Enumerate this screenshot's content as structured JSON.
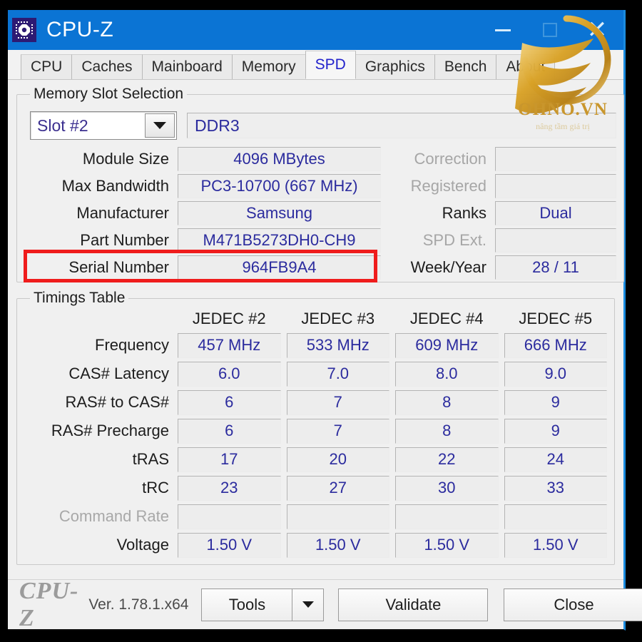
{
  "window": {
    "title": "CPU-Z",
    "icon": "cpuz-chip-icon",
    "controls": {
      "minimize": "–",
      "maximize": "□",
      "close": "✕"
    }
  },
  "tabs": [
    {
      "label": "CPU",
      "active": false
    },
    {
      "label": "Caches",
      "active": false
    },
    {
      "label": "Mainboard",
      "active": false
    },
    {
      "label": "Memory",
      "active": false
    },
    {
      "label": "SPD",
      "active": true
    },
    {
      "label": "Graphics",
      "active": false
    },
    {
      "label": "Bench",
      "active": false
    },
    {
      "label": "About",
      "active": false
    }
  ],
  "slot_selection": {
    "legend": "Memory Slot Selection",
    "slot": "Slot #2",
    "memory_type": "DDR3",
    "left_rows": [
      {
        "label": "Module Size",
        "value": "4096 MBytes",
        "disabled": false
      },
      {
        "label": "Max Bandwidth",
        "value": "PC3-10700 (667 MHz)",
        "disabled": false
      },
      {
        "label": "Manufacturer",
        "value": "Samsung",
        "disabled": false
      },
      {
        "label": "Part Number",
        "value": "M471B5273DH0-CH9",
        "disabled": false
      },
      {
        "label": "Serial Number",
        "value": "964FB9A4",
        "disabled": false
      }
    ],
    "right_rows": [
      {
        "label": "Correction",
        "value": "",
        "disabled": true
      },
      {
        "label": "Registered",
        "value": "",
        "disabled": true
      },
      {
        "label": "Ranks",
        "value": "Dual",
        "disabled": false
      },
      {
        "label": "SPD Ext.",
        "value": "",
        "disabled": true
      },
      {
        "label": "Week/Year",
        "value": "28 / 11",
        "disabled": false
      }
    ]
  },
  "timings": {
    "legend": "Timings Table",
    "columns": [
      "JEDEC #2",
      "JEDEC #3",
      "JEDEC #4",
      "JEDEC #5"
    ],
    "rows": [
      {
        "label": "Frequency",
        "disabled": false,
        "values": [
          "457 MHz",
          "533 MHz",
          "609 MHz",
          "666 MHz"
        ]
      },
      {
        "label": "CAS# Latency",
        "disabled": false,
        "values": [
          "6.0",
          "7.0",
          "8.0",
          "9.0"
        ]
      },
      {
        "label": "RAS# to CAS#",
        "disabled": false,
        "values": [
          "6",
          "7",
          "8",
          "9"
        ]
      },
      {
        "label": "RAS# Precharge",
        "disabled": false,
        "values": [
          "6",
          "7",
          "8",
          "9"
        ]
      },
      {
        "label": "tRAS",
        "disabled": false,
        "values": [
          "17",
          "20",
          "22",
          "24"
        ]
      },
      {
        "label": "tRC",
        "disabled": false,
        "values": [
          "23",
          "27",
          "30",
          "33"
        ]
      },
      {
        "label": "Command Rate",
        "disabled": true,
        "values": [
          "",
          "",
          "",
          ""
        ]
      },
      {
        "label": "Voltage",
        "disabled": false,
        "values": [
          "1.50 V",
          "1.50 V",
          "1.50 V",
          "1.50 V"
        ]
      }
    ]
  },
  "footer": {
    "brand": "CPU-Z",
    "version": "Ver. 1.78.1.x64",
    "tools_label": "Tools",
    "tools_arrow": "▼",
    "validate_label": "Validate",
    "close_label": "Close"
  },
  "annotation": {
    "highlight_target": "Max Bandwidth",
    "highlight_color": "#ef1c1c"
  },
  "watermark": {
    "text": "OHNO.VN",
    "tagline": "nâng tầm giá trị",
    "color": "#c9962c"
  },
  "colors": {
    "titlebar": "#0b74d4",
    "value_text": "#2b2b9e",
    "active_tab_text": "#2222cc",
    "accent_red": "#ef1c1c",
    "gold": "#c9962c"
  }
}
